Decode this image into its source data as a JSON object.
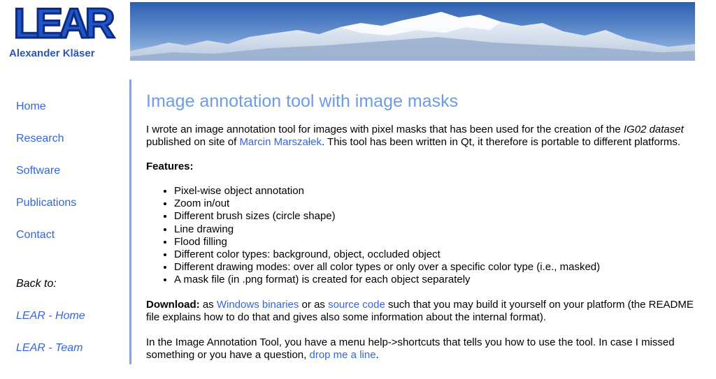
{
  "header": {
    "logo_text": "LEAR",
    "author_name": "Alexander Kläser"
  },
  "sidebar": {
    "items": [
      {
        "label": "Home"
      },
      {
        "label": "Research"
      },
      {
        "label": "Software"
      },
      {
        "label": "Publications"
      },
      {
        "label": "Contact"
      }
    ],
    "back_label": "Back to:",
    "back_links": [
      {
        "label": "LEAR - Home"
      },
      {
        "label": "LEAR - Team"
      }
    ]
  },
  "main": {
    "title": "Image annotation tool with image masks",
    "intro": {
      "text1": "I wrote an image annotation tool for images with pixel masks that has been used for the creation of the ",
      "dataset": "IG02 dataset",
      "text2": " published on site of ",
      "author_link": "Marcin Marszałek",
      "text3": ". This tool has been written in Qt, it therefore is portable to different platforms."
    },
    "features_heading": "Features:",
    "features": [
      "Pixel-wise object annotation",
      "Zoom in/out",
      "Different brush sizes (circle shape)",
      "Line drawing",
      "Flood filling",
      "Different color types: background, object, occluded object",
      "Different drawing modes: over all color types or only over a specific color type (i.e., masked)",
      "A mask file (in .png format) is created for each object separately"
    ],
    "download": {
      "label": "Download:",
      "text1": " as ",
      "windows_link": "Windows binaries",
      "text2": " or as ",
      "source_link": "source code",
      "text3": " such that you may build it yourself on your platform (the README file explains how to do that and gives also some information about the internal format)."
    },
    "usage": {
      "text1": "In the Image Annotation Tool, you have a menu help->shortcuts that tells you how to use the tool. In case I missed something or you have a question, ",
      "mail_link": "drop me a line",
      "text2": "."
    }
  },
  "colors": {
    "link": "#3566d8",
    "title": "#6d9be8",
    "divider": "#7aa6ee",
    "logo_blue": "#2a57b3"
  }
}
